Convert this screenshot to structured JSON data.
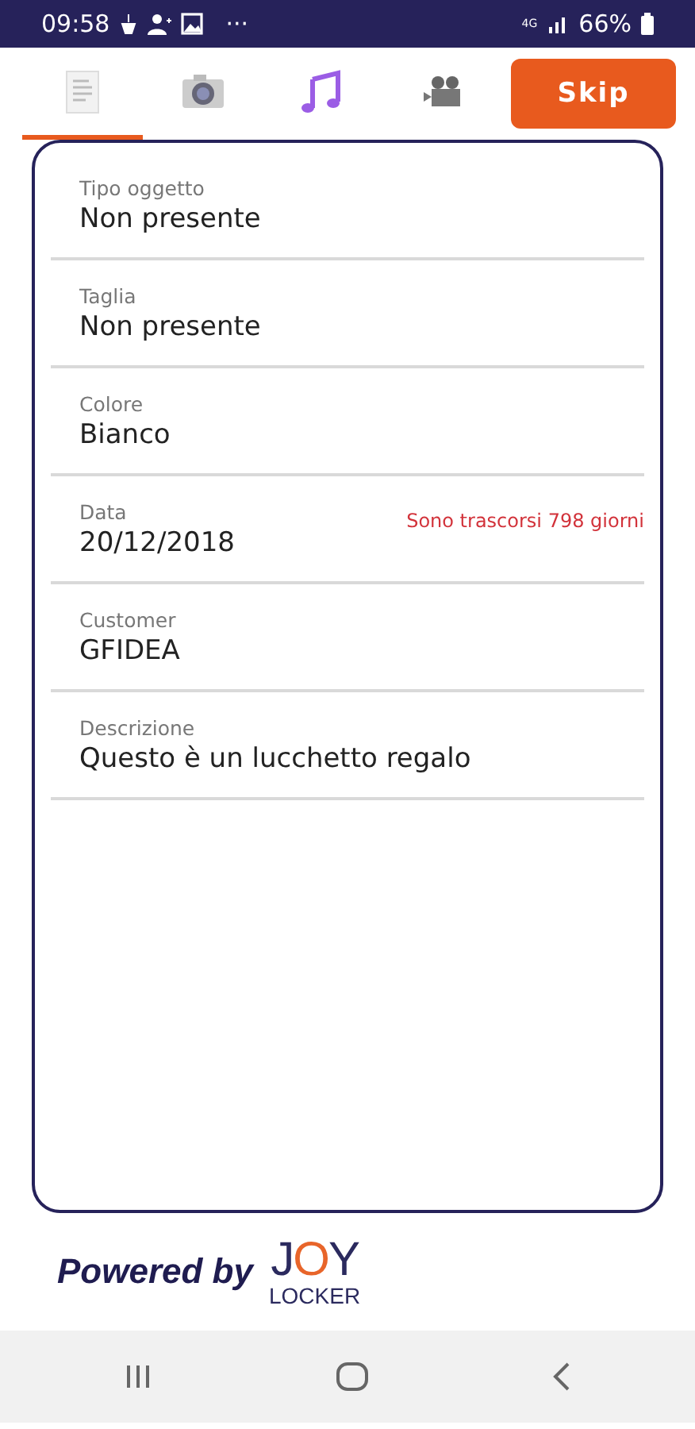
{
  "status_bar": {
    "time": "09:58",
    "more": "···",
    "network": "4G",
    "battery": "66%"
  },
  "tabs": [
    {
      "kind": "document",
      "selected": true
    },
    {
      "kind": "camera",
      "selected": false
    },
    {
      "kind": "music",
      "selected": false
    },
    {
      "kind": "video",
      "selected": false
    }
  ],
  "skip_button": "Skip",
  "fields": [
    {
      "label": "Tipo oggetto",
      "value": "Non presente"
    },
    {
      "label": "Taglia",
      "value": "Non presente"
    },
    {
      "label": "Colore",
      "value": "Bianco"
    },
    {
      "label": "Data",
      "value": "20/12/2018",
      "note": "Sono trascorsi 798 giorni"
    },
    {
      "label": "Customer",
      "value": "GFIDEA"
    },
    {
      "label": "Descrizione",
      "value": "Questo è un lucchetto regalo"
    }
  ],
  "footer": {
    "powered_by": "Powered by",
    "logo": [
      {
        "text": "J",
        "color": "#2b2a5e"
      },
      {
        "text": "O",
        "color": "#e8652a"
      },
      {
        "text": "Y",
        "color": "#2b2a5e"
      }
    ],
    "logo_sub": "LOCKER"
  }
}
